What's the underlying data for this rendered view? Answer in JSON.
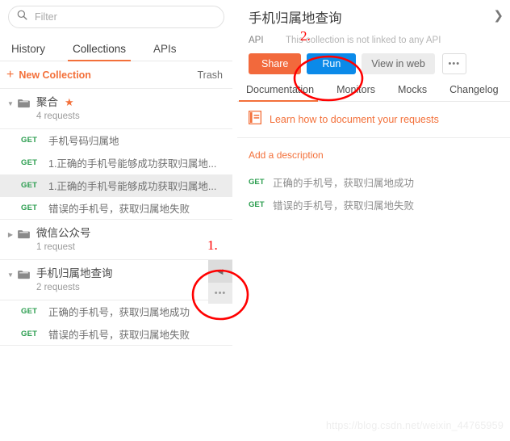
{
  "sidebar": {
    "search": {
      "placeholder": "Filter",
      "value": "",
      "icon": "search-icon"
    },
    "tabs": [
      {
        "label": "History",
        "active": false
      },
      {
        "label": "Collections",
        "active": true
      },
      {
        "label": "APIs",
        "active": false
      }
    ],
    "actions": {
      "new_collection_label": "New Collection",
      "new_collection_icon": "plus-icon",
      "trash_label": "Trash"
    },
    "collections": [
      {
        "name": "聚合",
        "count": "4 requests",
        "starred": true,
        "expanded": true,
        "caret": "▼",
        "requests": [
          {
            "method": "GET",
            "name": "手机号码归属地",
            "selected": false
          },
          {
            "method": "GET",
            "name": "1.正确的手机号能够成功获取归属地...",
            "selected": false
          },
          {
            "method": "GET",
            "name": "1.正确的手机号能够成功获取归属地...",
            "selected": true
          },
          {
            "method": "GET",
            "name": "错误的手机号，获取归属地失败",
            "selected": false
          }
        ]
      },
      {
        "name": "微信公众号",
        "count": "1 request",
        "starred": false,
        "expanded": false,
        "caret": "▶",
        "requests": []
      },
      {
        "name": "手机归属地查询",
        "count": "2 requests",
        "starred": false,
        "expanded": true,
        "caret": "▼",
        "requests": [
          {
            "method": "GET",
            "name": "正确的手机号，获取归属地成功",
            "selected": false
          },
          {
            "method": "GET",
            "name": "错误的手机号，获取归属地失败",
            "selected": false
          }
        ]
      }
    ],
    "hover_actions": {
      "collapse_label": "◀",
      "collapse_icon": "chevron-left-icon",
      "more_label": "•••",
      "more_icon": "ellipsis-icon"
    }
  },
  "right_panel": {
    "title": "手机归属地查询",
    "close_icon_label": "❯",
    "api_label": "API",
    "api_value": "This collection is not linked to any API",
    "buttons": {
      "share": "Share",
      "run": "Run",
      "view_in_web": "View in web",
      "more": "•••"
    },
    "tabs": [
      {
        "label": "Documentation",
        "active": true
      },
      {
        "label": "Monitors",
        "active": false
      },
      {
        "label": "Mocks",
        "active": false
      },
      {
        "label": "Changelog",
        "active": false
      }
    ],
    "learn_link": "Learn how to document your requests",
    "learn_icon": "book-icon",
    "add_description": "Add a description",
    "requests": [
      {
        "method": "GET",
        "name": "正确的手机号，获取归属地成功"
      },
      {
        "method": "GET",
        "name": "错误的手机号，获取归属地失败"
      }
    ]
  },
  "annotations": {
    "marker_one": "1.",
    "marker_two": "2.",
    "circle_color": "#ff0000"
  },
  "watermark": "https://blog.csdn.net/weixin_44765959",
  "colors": {
    "accent_orange": "#f3703a",
    "share_orange": "#f2693c",
    "run_blue": "#0b8ae9",
    "method_green": "#2a9d4e",
    "annotation_red": "#ff0000"
  }
}
